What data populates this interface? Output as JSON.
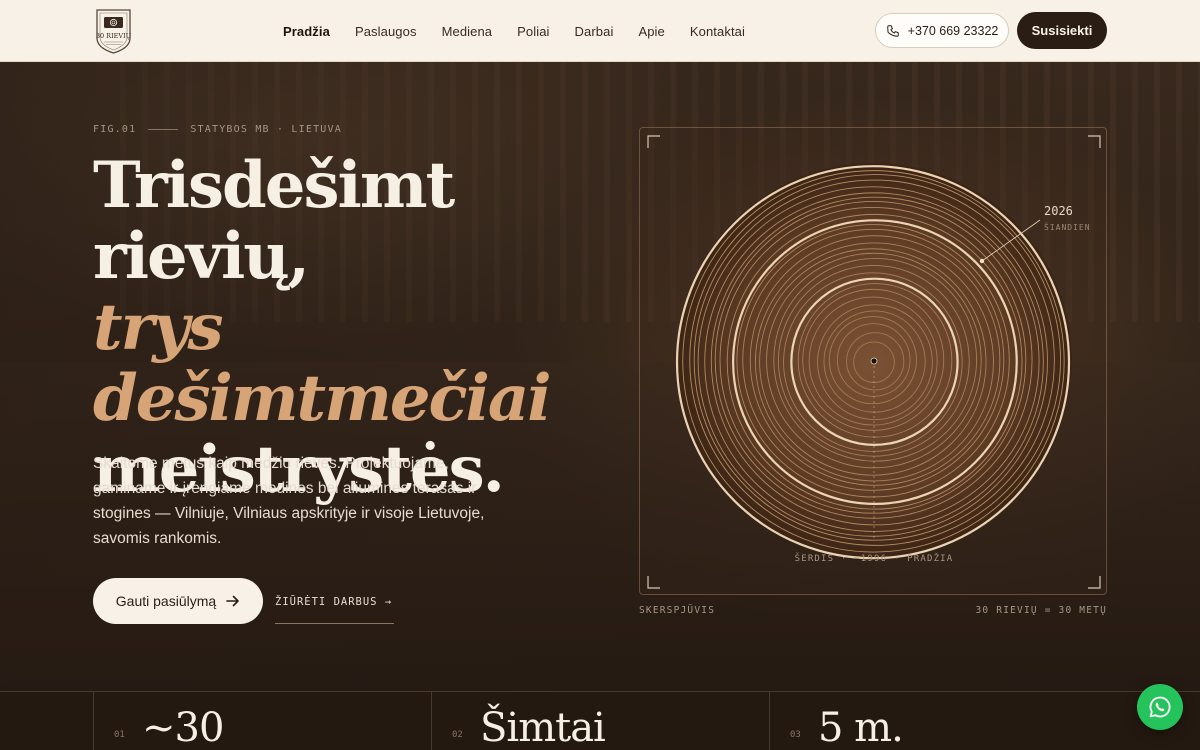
{
  "header": {
    "logo_text": "30 RIEVIŲ",
    "nav": [
      {
        "label": "Pradžia",
        "active": true
      },
      {
        "label": "Paslaugos"
      },
      {
        "label": "Mediena"
      },
      {
        "label": "Poliai"
      },
      {
        "label": "Darbai"
      },
      {
        "label": "Apie"
      },
      {
        "label": "Kontaktai"
      }
    ],
    "phone": "+370 669 23322",
    "cta": "Susisiekti"
  },
  "hero": {
    "eyebrow_left": "FIG.01",
    "eyebrow_right": "STATYBOS MB · LIETUVA",
    "headline_line1": "Trisdešimt",
    "headline_line2": "rievių,",
    "headline_accent": "trys dešimtmečiai",
    "headline_line4": "meistrystės.",
    "lead": "Skaitome metus kaip medžio rieves. Projektuojame, gaminame ir įrengiame medines bei aliumines terasas ir stogines — Vilniuje, Vilniaus apskrityje ir visoje Lietuvoje, savomis rankomis.",
    "primary_button": "Gauti pasiūlymą",
    "secondary_link": "ŽIŪRĖTI DARBUS →"
  },
  "figure": {
    "year_label": "2026",
    "year_sub": "ŠIANDIEN",
    "core_label": "ŠERDIS · ~1996 · PRADŽIA",
    "caption_left": "SKERSPJŪVIS",
    "caption_right": "30 RIEVIŲ = 30 METŲ",
    "ring_count": 30
  },
  "stats": [
    {
      "num": "01",
      "value": "~30"
    },
    {
      "num": "02",
      "value": "Šimtai"
    },
    {
      "num": "03",
      "value": "5 m."
    }
  ],
  "colors": {
    "accent": "#d6a477",
    "dark": "#2a1d14",
    "cream": "#f7f1e8",
    "whatsapp": "#25c35b"
  },
  "icons": {
    "phone": "phone-icon",
    "arrow": "arrow-right-icon",
    "whatsapp": "whatsapp-icon"
  }
}
